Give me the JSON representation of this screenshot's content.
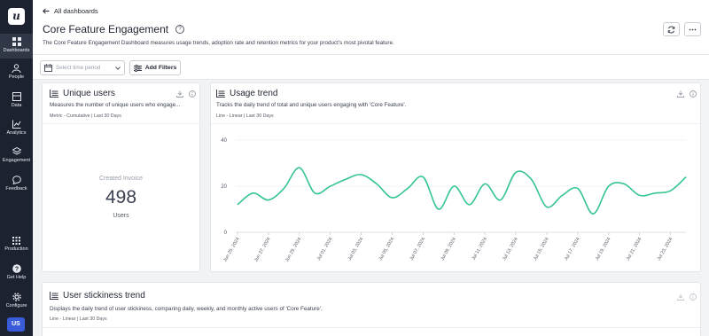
{
  "sidebar": {
    "logo_letter": "u",
    "items": [
      {
        "label": "Dashboards",
        "icon": "dashboards-icon",
        "active": true
      },
      {
        "label": "People",
        "icon": "people-icon"
      },
      {
        "label": "Data",
        "icon": "data-icon"
      },
      {
        "label": "Analytics",
        "icon": "analytics-icon"
      },
      {
        "label": "Engagement",
        "icon": "engagement-icon"
      },
      {
        "label": "Feedback",
        "icon": "feedback-icon"
      }
    ],
    "bottom_items": [
      {
        "label": "Production",
        "icon": "production-grid-icon"
      },
      {
        "label": "Get Help",
        "icon": "help-icon"
      },
      {
        "label": "Configure",
        "icon": "gear-icon"
      }
    ],
    "avatar": "US"
  },
  "header": {
    "back_label": "All dashboards",
    "title": "Core Feature Engagement",
    "help_glyph": "?",
    "description": "The Core Feature Engagement Dashboard measures usage trends, adoption rate and retention metrics for your product's most pivotal feature."
  },
  "filters": {
    "time_placeholder": "Select time period",
    "add_filters_label": "Add Filters"
  },
  "cards": {
    "unique_users": {
      "title": "Unique users",
      "description": "Measures the number of unique users who engage...",
      "meta": "Metric - Cumulative | Last 30 Days",
      "metric_label": "Created Invoice",
      "metric_value": "498",
      "metric_unit": "Users"
    },
    "usage_trend": {
      "title": "Usage trend",
      "description": "Tracks the daily trend of total and unique users engaging with 'Core Feature'.",
      "meta": "Line - Linear | Last 30 Days"
    },
    "stickiness": {
      "title": "User stickiness trend",
      "description": "Displays the daily trend of user stickiness, comparing daily, weekly, and monthly active users of 'Core Feature'.",
      "meta": "Line - Linear | Last 30 Days"
    }
  },
  "chart_data": {
    "type": "line",
    "title": "Usage trend",
    "x": [
      "Jun 25, 2024",
      "Jun 26, 2024",
      "Jun 27, 2024",
      "Jun 28, 2024",
      "Jun 29, 2024",
      "Jun 30, 2024",
      "Jul 01, 2024",
      "Jul 02, 2024",
      "Jul 03, 2024",
      "Jul 04, 2024",
      "Jul 05, 2024",
      "Jul 06, 2024",
      "Jul 07, 2024",
      "Jul 08, 2024",
      "Jul 09, 2024",
      "Jul 10, 2024",
      "Jul 11, 2024",
      "Jul 12, 2024",
      "Jul 13, 2024",
      "Jul 14, 2024",
      "Jul 15, 2024",
      "Jul 16, 2024",
      "Jul 17, 2024",
      "Jul 18, 2024",
      "Jul 19, 2024",
      "Jul 20, 2024",
      "Jul 21, 2024",
      "Jul 22, 2024",
      "Jul 23, 2024",
      "Jul 24, 2024"
    ],
    "x_tick_labels": [
      "Jun 25, 2024",
      "Jun 27, 2024",
      "Jun 29, 2024",
      "Jul 01, 2024",
      "Jul 03, 2024",
      "Jul 05, 2024",
      "Jul 07, 2024",
      "Jul 09, 2024",
      "Jul 11, 2024",
      "Jul 13, 2024",
      "Jul 15, 2024",
      "Jul 17, 2024",
      "Jul 19, 2024",
      "Jul 21, 2024",
      "Jul 23, 2024"
    ],
    "series": [
      {
        "values": [
          12,
          17,
          14,
          19,
          28,
          17,
          20,
          23,
          25,
          21,
          15,
          19,
          24,
          10,
          20,
          12,
          21,
          14,
          26,
          23,
          11,
          16,
          19,
          8,
          20,
          21,
          16,
          17,
          18,
          24
        ],
        "color": "#35c58f"
      }
    ],
    "ylim": [
      0,
      40
    ],
    "y_ticks": [
      0,
      20,
      40
    ],
    "grid": "horizontal"
  }
}
